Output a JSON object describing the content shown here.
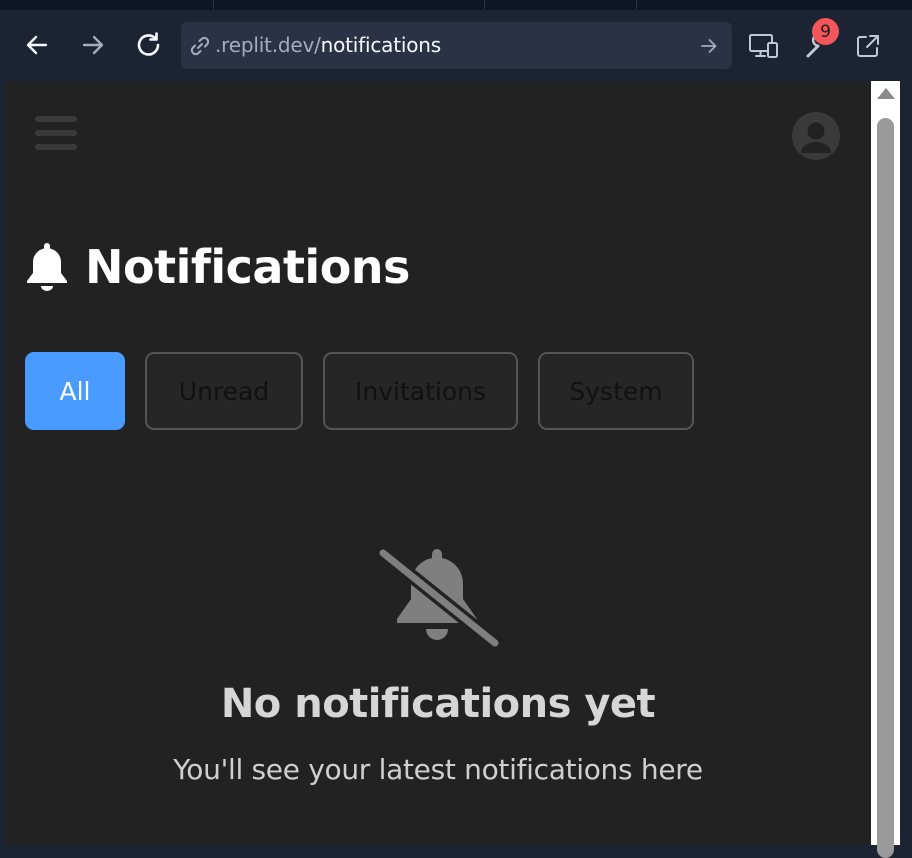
{
  "browser": {
    "url_host": ".replit.dev/",
    "url_path": "notifications",
    "badge_count": "9",
    "icons": [
      "back-arrow-icon",
      "forward-arrow-icon",
      "reload-icon",
      "link-icon",
      "go-arrow-icon",
      "devices-icon",
      "devtools-wrench-icon",
      "open-external-icon"
    ]
  },
  "header": {
    "menu_icon": "hamburger-icon",
    "avatar_icon": "user-avatar-icon"
  },
  "page": {
    "title": "Notifications",
    "title_icon": "bell-icon"
  },
  "filters": [
    {
      "label": "All",
      "active": true
    },
    {
      "label": "Unread",
      "active": false
    },
    {
      "label": "Invitations",
      "active": false
    },
    {
      "label": "System",
      "active": false
    }
  ],
  "empty_state": {
    "icon": "bell-slash-icon",
    "title": "No notifications yet",
    "subtitle": "You'll see your latest notifications here"
  },
  "colors": {
    "chrome_bg": "#1c2333",
    "page_bg": "#222222",
    "accent": "#4a9bff",
    "badge": "#f2555a"
  }
}
